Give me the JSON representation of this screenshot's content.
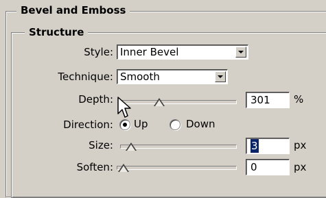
{
  "panel": {
    "title": "Bevel and Emboss",
    "structure_title": "Structure"
  },
  "fields": {
    "style": {
      "label": "Style:",
      "value": "Inner Bevel"
    },
    "technique": {
      "label": "Technique:",
      "value": "Smooth"
    },
    "depth": {
      "label": "Depth:",
      "value": "301",
      "unit": "%",
      "slider_fraction": 0.32
    },
    "direction": {
      "label": "Direction:",
      "options": [
        "Up",
        "Down"
      ],
      "selected": "Up"
    },
    "size": {
      "label": "Size:",
      "value": "3",
      "unit": "px",
      "slider_fraction": 0.05
    },
    "soften": {
      "label": "Soften:",
      "value": "0",
      "unit": "px",
      "slider_fraction": 0.0
    }
  },
  "icons": {
    "cursor": "arrow-pointer-icon",
    "dropdown_arrow": "chevron-down-icon"
  },
  "colors": {
    "background": "#d4d0c8",
    "selection": "#0a246a"
  }
}
